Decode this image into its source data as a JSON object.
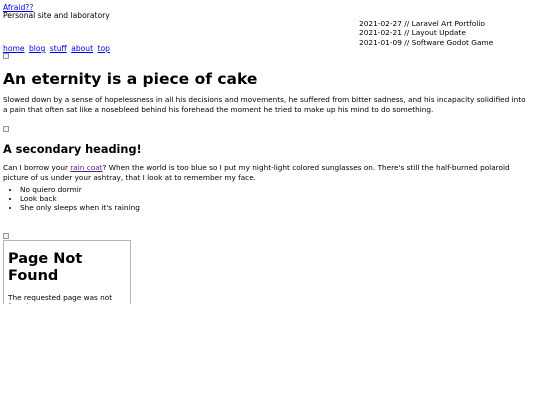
{
  "header": {
    "site_title": "Afraid??",
    "site_description": "Personal site and laboratory"
  },
  "recent_posts": [
    "2021-02-27 // Laravel Art Portfolio",
    "2021-02-21 // Layout Update",
    "2021-01-09 // Software Godot Game"
  ],
  "nav": [
    "home",
    "blog",
    "stuff",
    "about",
    "top"
  ],
  "article": {
    "title": "An eternity is a piece of cake",
    "intro": "Slowed down by a sense of hopelessness in all his decisions and movements, he suffered from bitter sadness, and his incapacity solidified into a pain that often sat like a nosebleed behind his forehead the moment he tried to make up his mind to do something.",
    "secondary_heading": "A secondary heading!",
    "para_before_link": "Can I borrow your ",
    "link_text": "rain coat",
    "para_after_link": "? When the world is too blue so I put my night-light colored sunglasses on. There's still the half-burned polaroid picture of us under your ashtray, that I look at to remember my face.",
    "bullets": [
      "No quiero dormir",
      "Look back",
      "She only sleeps when it's raining"
    ]
  },
  "embed": {
    "title": "Page Not Found",
    "text": "The requested page was not found."
  }
}
